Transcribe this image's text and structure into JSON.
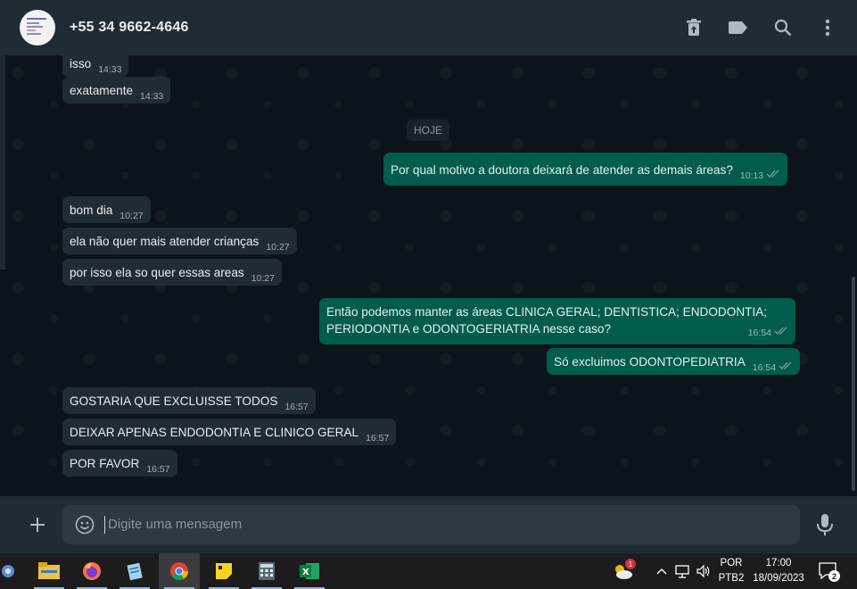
{
  "header": {
    "contact": "+55 34 9662-4646",
    "icons": [
      "delete-icon",
      "label-icon",
      "search-icon",
      "menu-icon"
    ]
  },
  "chat": {
    "date_divider": "HOJE",
    "messages": [
      {
        "dir": "in",
        "text": "isso",
        "time": "14:33"
      },
      {
        "dir": "in",
        "text": "exatamente",
        "time": "14:33"
      },
      {
        "dir": "out",
        "text": "Por qual motivo a doutora deixará de atender as demais áreas?",
        "time": "10:13"
      },
      {
        "dir": "in",
        "text": "bom dia",
        "time": "10:27"
      },
      {
        "dir": "in",
        "text": "ela não quer mais atender crianças",
        "time": "10:27"
      },
      {
        "dir": "in",
        "text": "por isso ela so quer essas areas",
        "time": "10:27"
      },
      {
        "dir": "out",
        "text": "Então podemos manter as áreas CLINICA GERAL; DENTISTICA; ENDODONTIA; PERIODONTIA e ODONTOGERIATRIA nesse caso?",
        "time": "16:54"
      },
      {
        "dir": "out",
        "text": "Só excluimos ODONTOPEDIATRIA",
        "time": "16:54"
      },
      {
        "dir": "in",
        "text": "GOSTARIA QUE EXCLUISSE TODOS",
        "time": "16:57"
      },
      {
        "dir": "in",
        "text": "DEIXAR APENAS ENDODONTIA E CLINICO GERAL",
        "time": "16:57"
      },
      {
        "dir": "in",
        "text": "POR FAVOR",
        "time": "16:57"
      }
    ]
  },
  "composer": {
    "placeholder": "Digite uma mensagem"
  },
  "colors": {
    "incoming_bubble": "#202c33",
    "outgoing_bubble": "#005c4b",
    "background": "#0b141a",
    "header": "#202c33"
  },
  "taskbar": {
    "apps": [
      "file-explorer-icon",
      "firefox-icon",
      "notepad-icon",
      "chrome-icon",
      "sticky-notes-icon",
      "calculator-icon",
      "excel-icon"
    ],
    "active_app": "chrome-icon",
    "language_top": "POR",
    "language_bottom": "PTB2",
    "time": "17:00",
    "date": "18/09/2023",
    "notification_count": "2",
    "tray_badge": "1"
  }
}
